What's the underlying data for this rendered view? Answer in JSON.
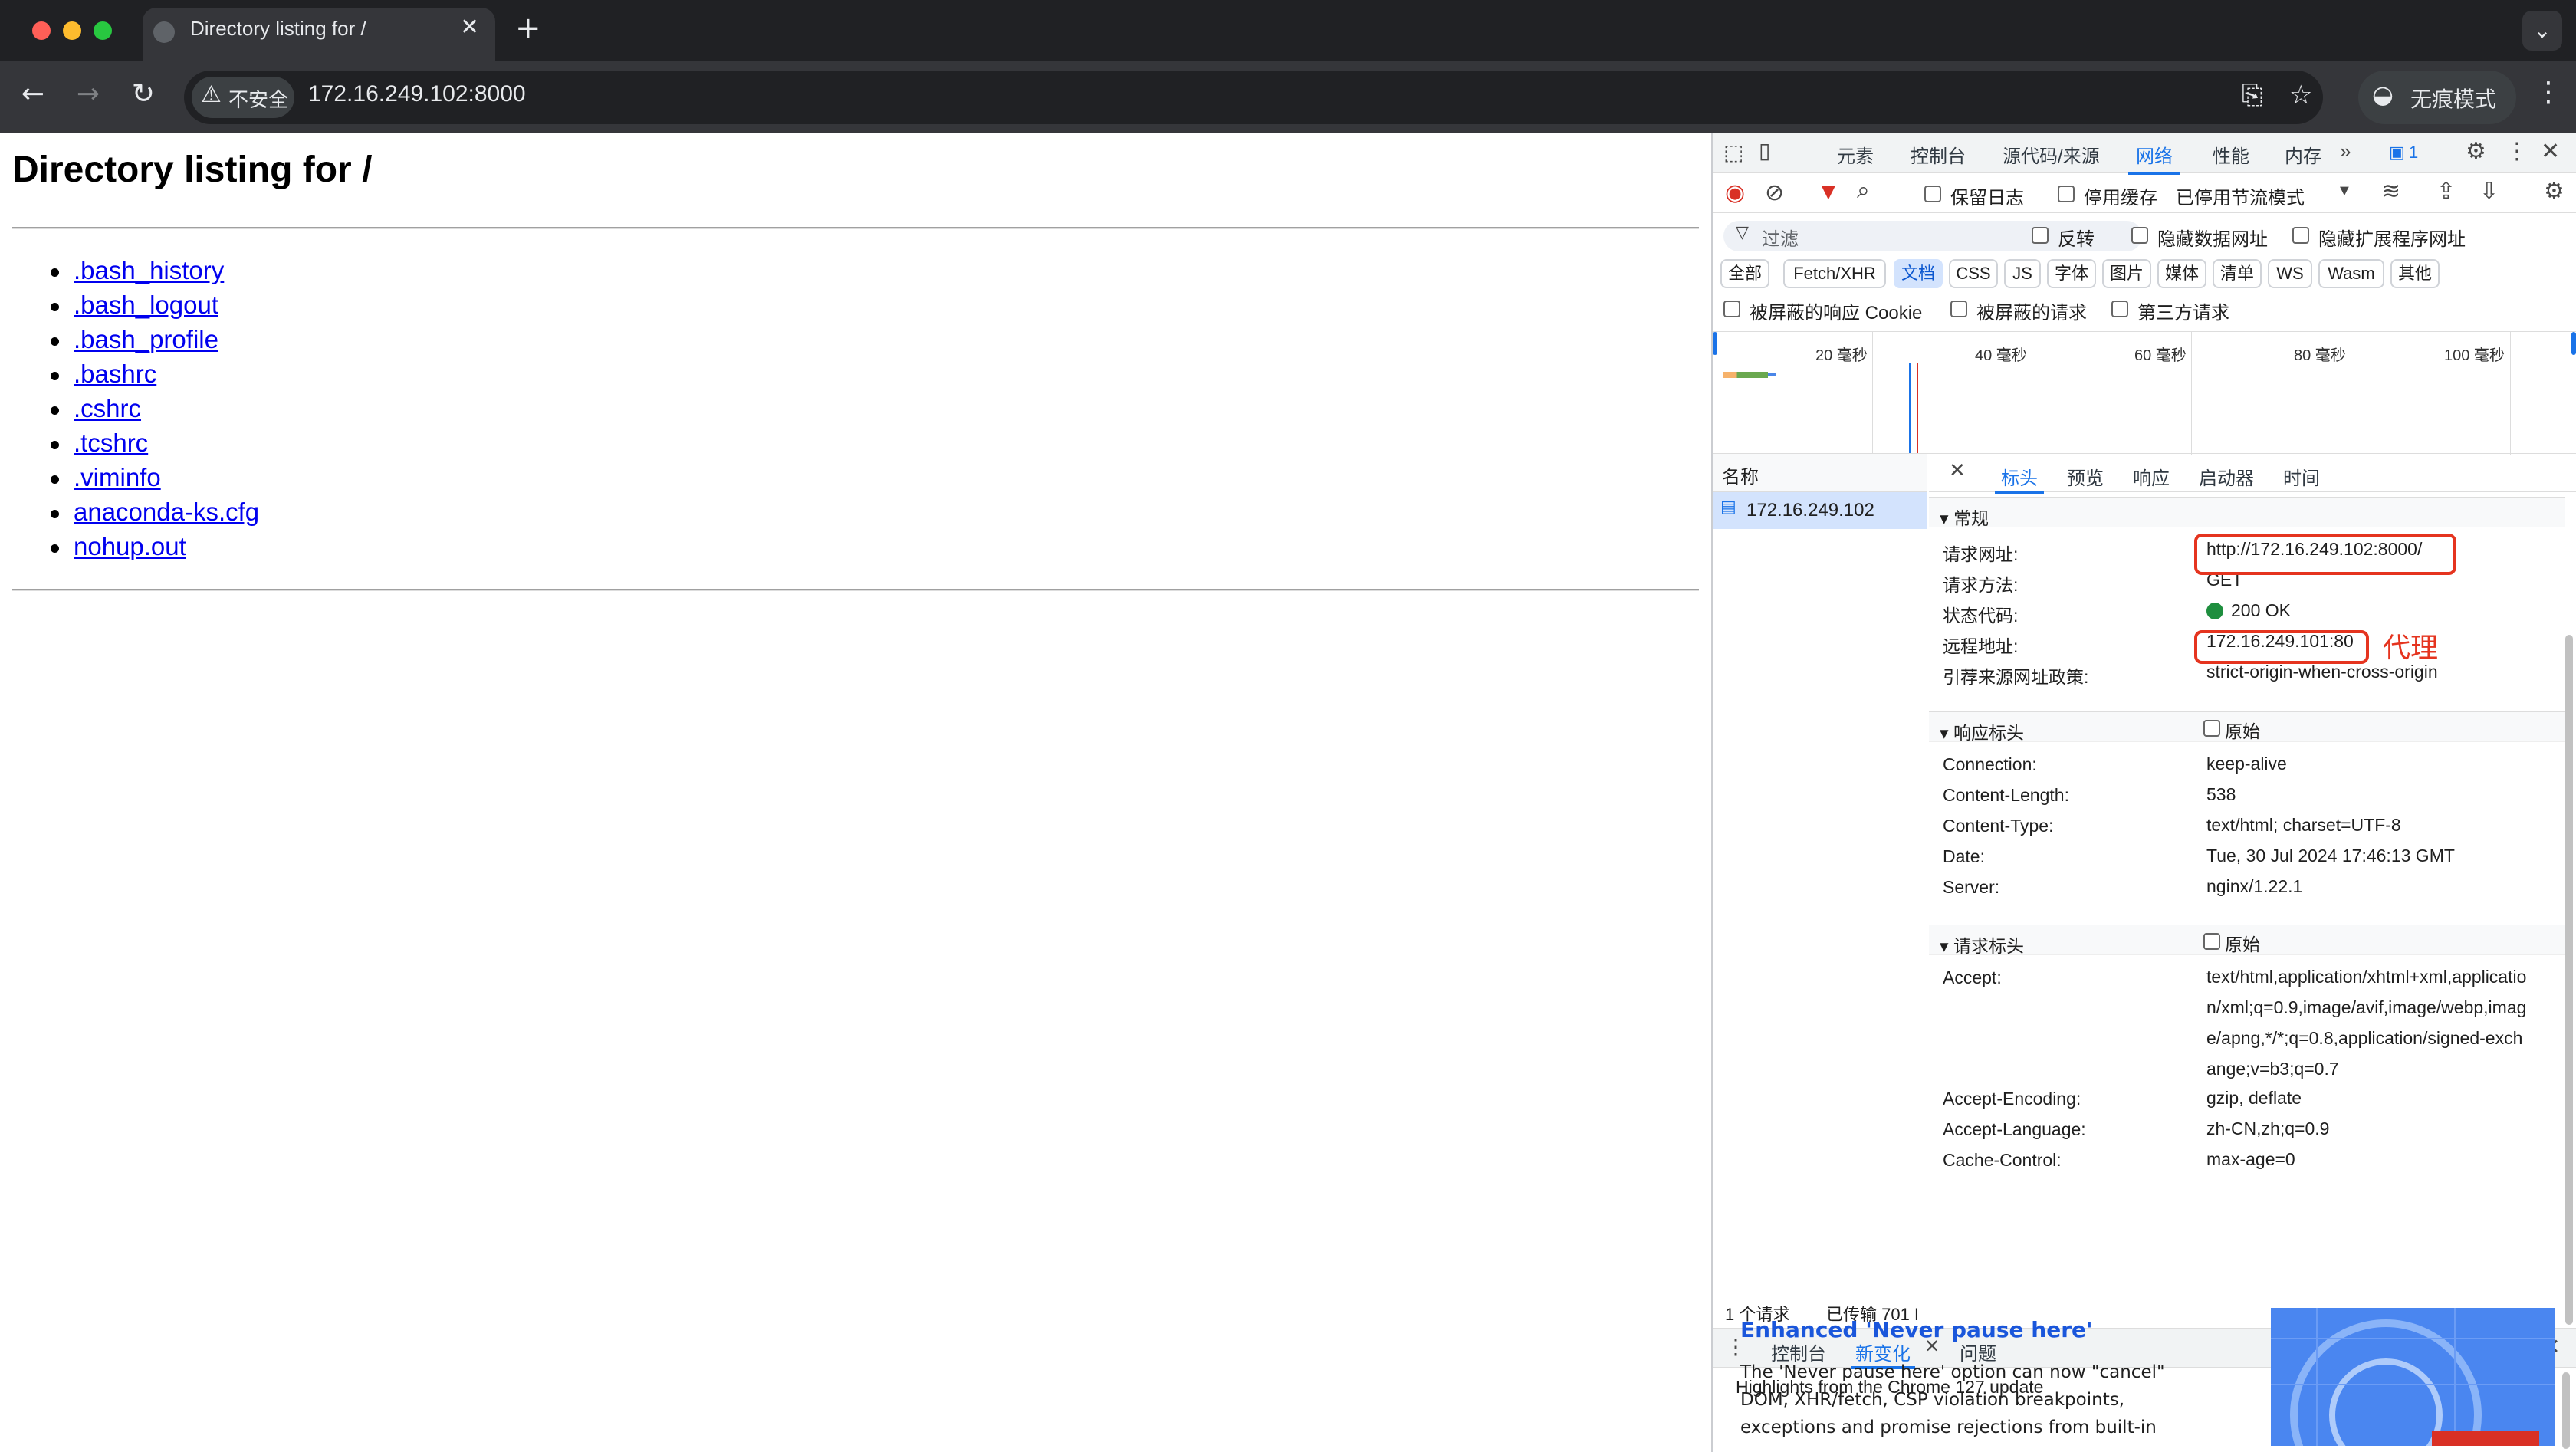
{
  "browser": {
    "tab_title": "Directory listing for /",
    "new_tab": "+",
    "tab_list_btn": "⌄",
    "security_label": "不安全",
    "url": "172.16.249.102:8000",
    "incognito_label": "无痕模式"
  },
  "page": {
    "heading": "Directory listing for /",
    "files": [
      ".bash_history",
      ".bash_logout",
      ".bash_profile",
      ".bashrc",
      ".cshrc",
      ".tcshrc",
      ".viminfo",
      "anaconda-ks.cfg",
      "nohup.out"
    ]
  },
  "devtools": {
    "tabs": [
      "元素",
      "控制台",
      "源代码/来源",
      "网络",
      "性能",
      "内存"
    ],
    "active_tab": "网络",
    "issues_count": "1",
    "preserve_log": "保留日志",
    "disable_cache": "停用缓存",
    "throttling": "已停用节流模式",
    "filter_placeholder": "过滤",
    "invert": "反转",
    "hide_data_urls": "隐藏数据网址",
    "hide_ext_urls": "隐藏扩展程序网址",
    "type_filters": [
      "全部",
      "Fetch/XHR",
      "文档",
      "CSS",
      "JS",
      "字体",
      "图片",
      "媒体",
      "清单",
      "WS",
      "Wasm",
      "其他"
    ],
    "blocked_cookies": "被屏蔽的响应 Cookie",
    "blocked_requests": "被屏蔽的请求",
    "third_party": "第三方请求",
    "timeline_labels": [
      "20 毫秒",
      "40 毫秒",
      "60 毫秒",
      "80 毫秒",
      "100 毫秒"
    ],
    "name_header": "名称",
    "request_name": "172.16.249.102",
    "status_requests": "1 个请求",
    "status_transferred": "已传输 701 I",
    "detail_tabs": [
      "标头",
      "预览",
      "响应",
      "启动器",
      "时间"
    ],
    "general": {
      "title": "常规",
      "rows": [
        {
          "k": "请求网址:",
          "v": "http://172.16.249.102:8000/"
        },
        {
          "k": "请求方法:",
          "v": "GET"
        },
        {
          "k": "状态代码:",
          "v": "200 OK"
        },
        {
          "k": "远程地址:",
          "v": "172.16.249.101:80"
        },
        {
          "k": "引荐来源网址政策:",
          "v": "strict-origin-when-cross-origin"
        }
      ]
    },
    "annotation_proxy": "代理",
    "response_headers": {
      "title": "响应标头",
      "raw": "原始",
      "rows": [
        {
          "k": "Connection:",
          "v": "keep-alive"
        },
        {
          "k": "Content-Length:",
          "v": "538"
        },
        {
          "k": "Content-Type:",
          "v": "text/html; charset=UTF-8"
        },
        {
          "k": "Date:",
          "v": "Tue, 30 Jul 2024 17:46:13 GMT"
        },
        {
          "k": "Server:",
          "v": "nginx/1.22.1"
        }
      ]
    },
    "request_headers": {
      "title": "请求标头",
      "raw": "原始",
      "rows": [
        {
          "k": "Accept:",
          "v": "text/html,application/xhtml+xml,application/xml;q=0.9,image/avif,image/webp,image/apng,*/*;q=0.8,application/signed-exchange;v=b3;q=0.7"
        },
        {
          "k": "Accept-Encoding:",
          "v": "gzip, deflate"
        },
        {
          "k": "Accept-Language:",
          "v": "zh-CN,zh;q=0.9"
        },
        {
          "k": "Cache-Control:",
          "v": "max-age=0"
        }
      ]
    },
    "drawer": {
      "tabs": [
        "控制台",
        "新变化",
        "问题"
      ],
      "active": "新变化",
      "highlights": "Highlights from the Chrome 127 update",
      "feature_title": "Enhanced 'Never pause here'",
      "feature_body": "The 'Never pause here' option can now \"cancel\" DOM, XHR/fetch, CSP violation breakpoints, exceptions and promise rejections from built-in"
    }
  },
  "colors": {
    "accent": "#1a73e8",
    "annotation": "#e5341f",
    "status_ok": "#1e8e3e"
  }
}
